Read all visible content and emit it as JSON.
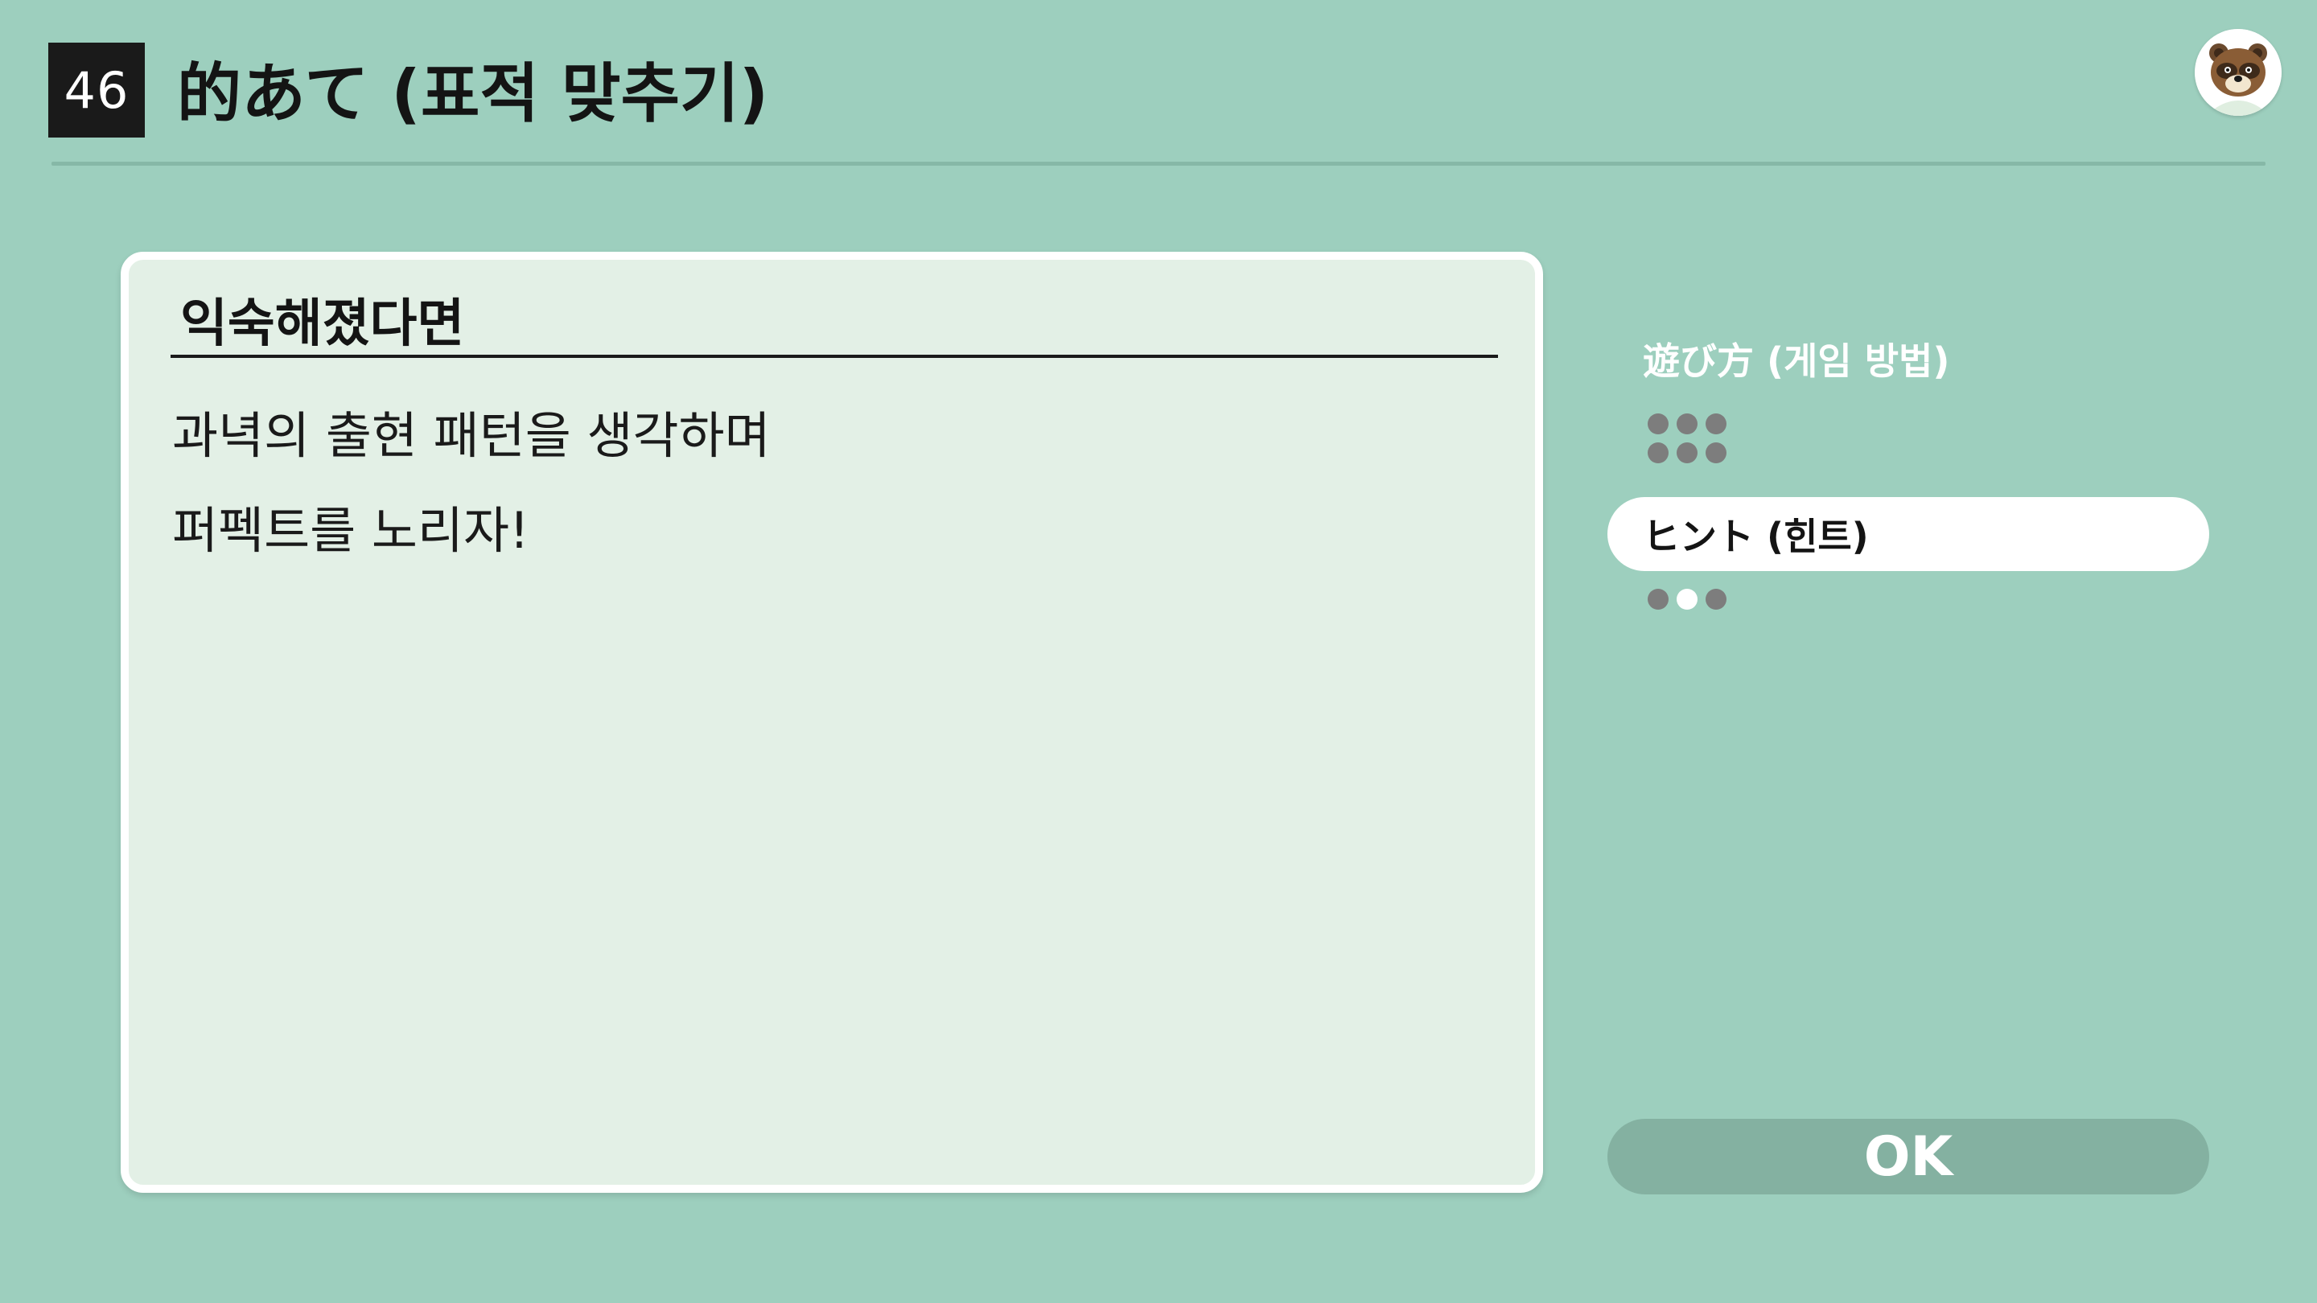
{
  "header": {
    "game_number": "46",
    "title": "的あて (표적 맞추기)"
  },
  "panel": {
    "heading": "익숙해졌다면",
    "lines": [
      "과녁의 출현 패턴을 생각하며",
      "퍼펙트를 노리자!"
    ]
  },
  "menu": {
    "items": [
      {
        "label": "遊び方 (게임 방법)",
        "active": false,
        "pages": 6,
        "current_page": 0
      },
      {
        "label": "ヒント (힌트)",
        "active": true,
        "pages": 3,
        "current_page": 2
      }
    ]
  },
  "ok_button": {
    "label": "OK"
  },
  "colors": {
    "background": "#9dcfbe",
    "panel": "#e3f0e6",
    "ok_button": "#84b1a1",
    "dot_inactive": "#7d7d7d",
    "dot_active": "#ffffff"
  },
  "icons": {
    "avatar": "tom-nook-avatar-icon"
  }
}
